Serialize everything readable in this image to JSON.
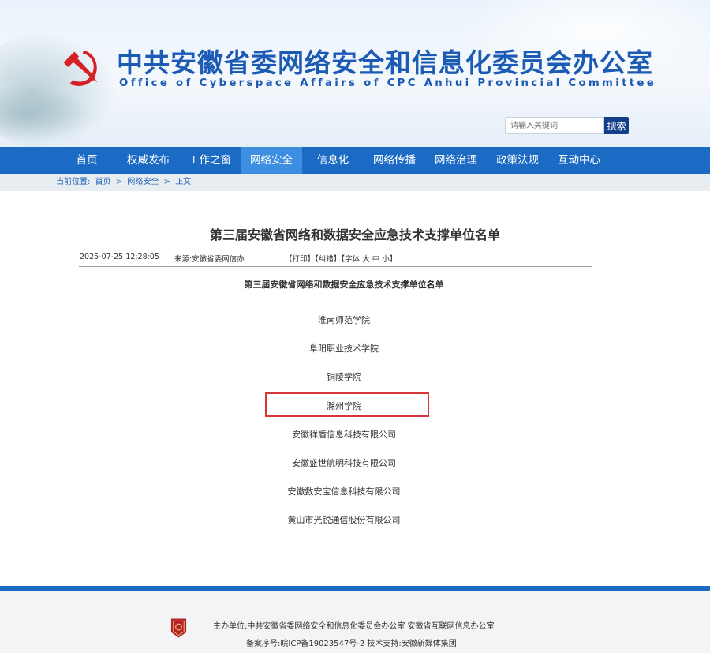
{
  "header": {
    "title": "中共安徽省委网络安全和信息化委员会办公室",
    "subtitle": "Office of Cyberspace Affairs of CPC Anhui Provincial Committee",
    "search_placeholder": "请输入关键词",
    "search_button": "搜索",
    "emblem_icon": "party-emblem-icon",
    "brand_color": "#1c5bb4"
  },
  "nav": {
    "items": [
      "首页",
      "权威发布",
      "工作之窗",
      "网络安全",
      "信息化",
      "网络传播",
      "网络治理",
      "政策法规",
      "互动中心"
    ],
    "active": "网络安全",
    "color": "#1b6ac4",
    "active_color": "#3d8ee0"
  },
  "breadcrumb": {
    "prefix": "当前位置:",
    "home": "首页",
    "sep1": ">",
    "section": "网络安全",
    "sep2": ">",
    "current": "正文"
  },
  "article": {
    "title": "第三届安徽省网络和数据安全应急技术支撑单位名单",
    "date": "2025-07-25 12:28:05",
    "source": "来源:安徽省委网信办",
    "tools": "【打印】【纠错】【字体:大 中 小】",
    "subheading": "第三届安徽省网络和数据安全应急技术支撑单位名单",
    "units": [
      "淮南师范学院",
      "阜阳职业技术学院",
      "铜陵学院",
      "滁州学院",
      "安徽祥盾信息科技有限公司",
      "安徽盛世航明科技有限公司",
      "安徽数安宝信息科技有限公司",
      "黄山市光锐通信股份有限公司"
    ],
    "highlighted_unit": "滁州学院",
    "highlight_color": "#d9343a"
  },
  "footer": {
    "line1": "主办单位:中共安徽省委网络安全和信息化委员会办公室 安徽省互联网信息办公室",
    "line2": "备案序号:皖ICP备19023547号-2 技术支持:安徽新媒体集团",
    "badge_icon": "gov-badge-icon"
  }
}
